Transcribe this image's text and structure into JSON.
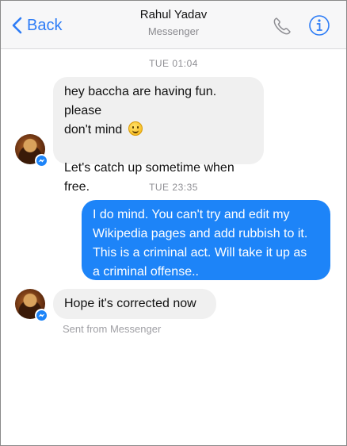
{
  "header": {
    "back_label": "Back",
    "contact_name": "Rahul Yadav",
    "subtitle": "Messenger",
    "call_icon": "phone-icon",
    "info_icon": "info-icon",
    "accent_color": "#2d7cf6"
  },
  "thread": {
    "timestamps": [
      "TUE 01:04",
      "TUE 23:35"
    ],
    "messages": [
      {
        "direction": "incoming",
        "lines": [
          "hey baccha are having fun. please",
          "don't mind",
          "",
          "Let's catch up sometime when free."
        ],
        "emoji": "smiling-face-emoji"
      },
      {
        "direction": "outgoing",
        "lines": [
          "I do mind. You can't try and edit my",
          "Wikipedia pages and add rubbish to it.",
          "This is a criminal act. Will take it up as",
          "a criminal offense.."
        ]
      },
      {
        "direction": "incoming",
        "lines": [
          "Hope it's corrected now"
        ]
      }
    ],
    "sent_from": "Sent from Messenger"
  },
  "colors": {
    "incoming_bubble": "#f0f0f0",
    "outgoing_bubble": "#1d84f8",
    "timestamp": "#8e8e93"
  }
}
